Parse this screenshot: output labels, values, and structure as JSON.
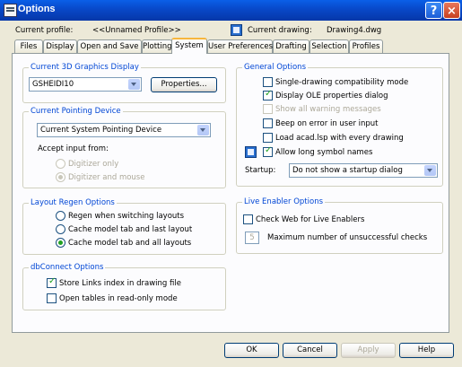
{
  "window": {
    "title": "Options",
    "help_glyph": "?",
    "close_glyph": "×"
  },
  "profile": {
    "label": "Current profile:",
    "value": "<<Unnamed Profile>>"
  },
  "drawing": {
    "label": "Current drawing:",
    "value": "Drawing4.dwg"
  },
  "tabs": [
    "Files",
    "Display",
    "Open and Save",
    "Plotting",
    "System",
    "User Preferences",
    "Drafting",
    "Selection",
    "Profiles"
  ],
  "active_tab": "System",
  "graphics": {
    "title": "Current 3D Graphics Display",
    "selected": "GSHEIDI10",
    "properties_button": "Properties..."
  },
  "pointing": {
    "title": "Current Pointing Device",
    "selected": "Current System Pointing Device",
    "accept_label": "Accept input from:",
    "options": [
      "Digitizer only",
      "Digitizer and mouse"
    ]
  },
  "layout": {
    "title": "Layout Regen Options",
    "options": [
      "Regen when switching layouts",
      "Cache model tab and last layout",
      "Cache model tab and all layouts"
    ]
  },
  "dbconnect": {
    "title": "dbConnect Options",
    "options": [
      "Store Links index in drawing file",
      "Open tables in read-only mode"
    ]
  },
  "general": {
    "title": "General Options",
    "options": [
      "Single-drawing compatibility mode",
      "Display OLE properties dialog",
      "Show all warning messages",
      "Beep on error in user input",
      "Load acad.lsp with every drawing",
      "Allow long symbol names"
    ],
    "startup_label": "Startup:",
    "startup_value": "Do not show a startup dialog"
  },
  "live_enabler": {
    "title": "Live Enabler Options",
    "check_label": "Check Web for Live Enablers",
    "max_value": "5",
    "max_label": "Maximum number of unsuccessful checks"
  },
  "buttons": {
    "ok": "OK",
    "cancel": "Cancel",
    "apply": "Apply",
    "help": "Help"
  }
}
